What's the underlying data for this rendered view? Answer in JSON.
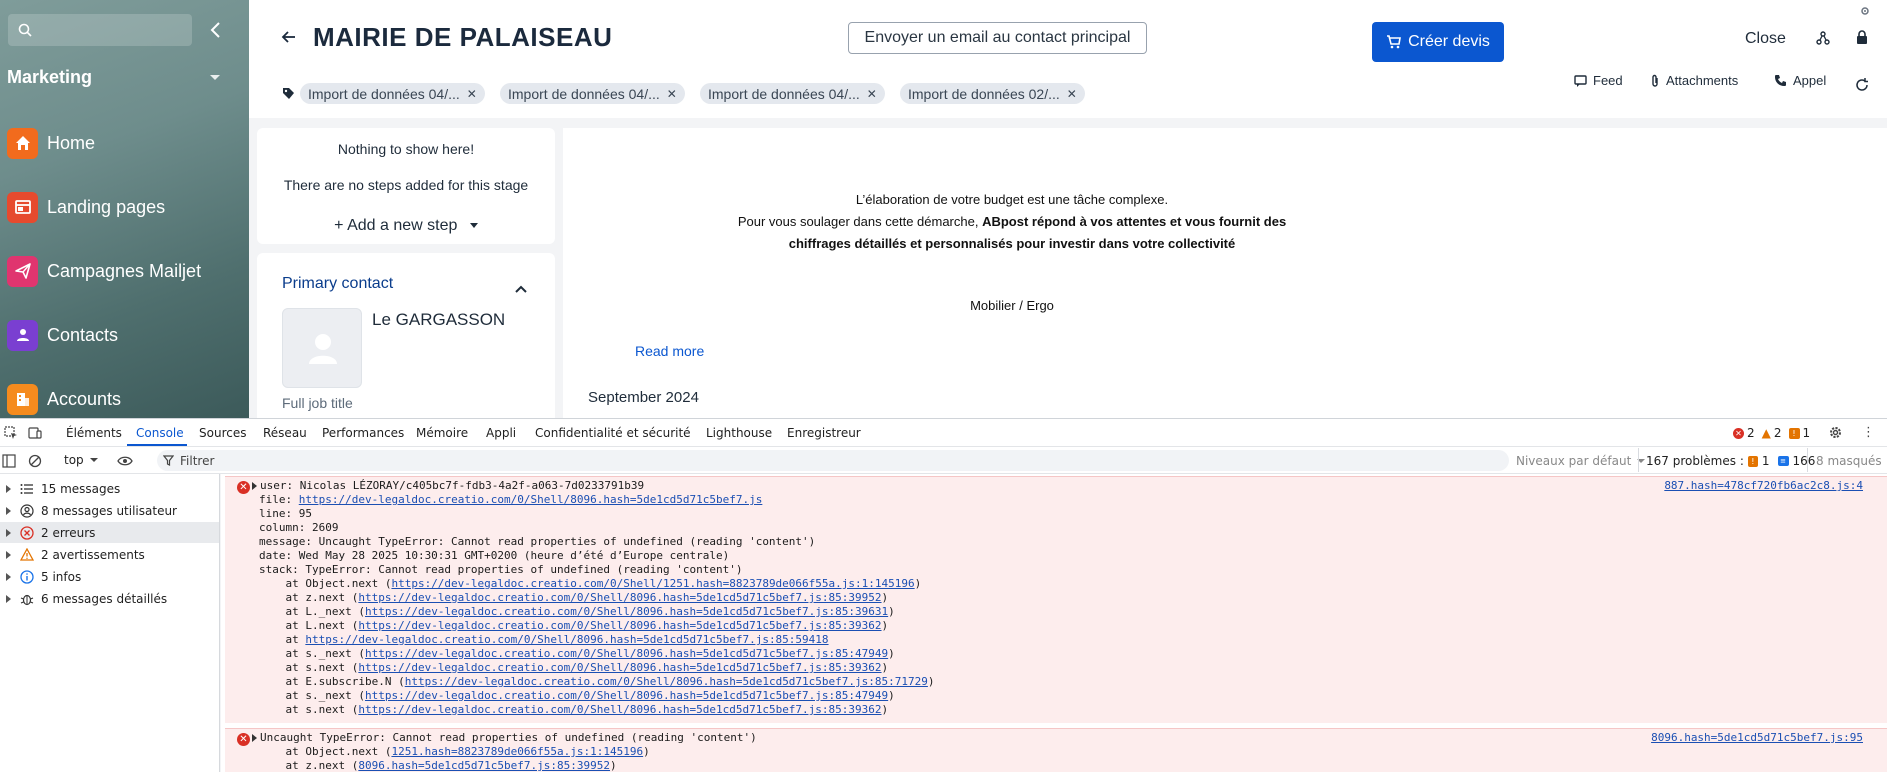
{
  "sidebar": {
    "workspace": "Marketing",
    "items": [
      {
        "label": "Home",
        "icon": "home-icon",
        "color": "#f26b1d"
      },
      {
        "label": "Landing pages",
        "icon": "landing-pages-icon",
        "color": "#e64a2e"
      },
      {
        "label": "Campagnes Mailjet",
        "icon": "send-icon",
        "color": "#e0356f"
      },
      {
        "label": "Contacts",
        "icon": "contact-icon",
        "color": "#7a3fd1"
      },
      {
        "label": "Accounts",
        "icon": "accounts-icon",
        "color": "#f58b1e"
      }
    ]
  },
  "header": {
    "title": "MAIRIE DE PALAISEAU",
    "email_button": "Envoyer un email au contact principal",
    "create_button": "Créer devis",
    "close": "Close",
    "tags": [
      "Import de données 04/...",
      "Import de données 04/...",
      "Import de données 04/...",
      "Import de données 02/..."
    ],
    "actions": {
      "feed": "Feed",
      "attachments": "Attachments",
      "call": "Appel"
    }
  },
  "steps": {
    "empty_title": "Nothing to show here!",
    "empty_text": "There are no steps added for this stage",
    "add_step": "Add a new step"
  },
  "contact": {
    "title": "Primary contact",
    "name": "Le GARGASSON",
    "job_title": "Full job title"
  },
  "feed": {
    "line1": "L’élaboration de votre budget est une tâche complexe.",
    "line2_plain": "Pour vous soulager dans cette démarche, ",
    "line2_bold": "ABpost répond à vos attentes et vous fournit des",
    "line3_bold": "chiffrages détaillés et personnalisés pour investir dans votre collectivité",
    "line4": "Mobilier / Ergo",
    "read_more": "Read more",
    "date": "September 2024"
  },
  "devtools": {
    "tabs": [
      "Éléments",
      "Console",
      "Sources",
      "Réseau",
      "Performances",
      "Mémoire",
      "Appli",
      "Confidentialité et sécurité",
      "Lighthouse",
      "Enregistreur"
    ],
    "badges": {
      "errors": "2",
      "warnings": "2",
      "issues": "1"
    },
    "context": "top",
    "filter_placeholder": "Filtrer",
    "levels": "Niveaux par défaut",
    "problems_label": "167 problèmes :",
    "problems_issues": "1",
    "problems_info": "166",
    "hidden": "8 masqués",
    "sidebar": [
      {
        "label": "15 messages",
        "icon": "list-icon"
      },
      {
        "label": "8 messages utilisateur",
        "icon": "user-icon"
      },
      {
        "label": "2 erreurs",
        "icon": "error-icon"
      },
      {
        "label": "2 avertissements",
        "icon": "warning-icon"
      },
      {
        "label": "5 infos",
        "icon": "info-icon"
      },
      {
        "label": "6 messages détaillés",
        "icon": "bug-icon"
      }
    ],
    "error1": {
      "source": "887.hash=478cf720fb6ac2c8.js:4",
      "user": "user: Nicolas LÉZORAY/c405bc7f-fdb3-4a2f-a063-7d0233791b39",
      "file_label": "file: ",
      "file_url": "https://dev-legaldoc.creatio.com/0/Shell/8096.hash=5de1cd5d71c5bef7.js",
      "line": "line: 95",
      "column": "column: 2609",
      "message": "message: Uncaught TypeError: Cannot read properties of undefined (reading 'content')",
      "date": "date: Wed May 28 2025 10:30:31 GMT+0200 (heure d’été d’Europe centrale)",
      "stack": "stack: TypeError: Cannot read properties of undefined (reading 'content')",
      "frames": [
        {
          "prefix": "    at Object.next (",
          "url": "https://dev-legaldoc.creatio.com/0/Shell/1251.hash=8823789de066f55a.js:1:145196",
          "suffix": ")"
        },
        {
          "prefix": "    at z.next (",
          "url": "https://dev-legaldoc.creatio.com/0/Shell/8096.hash=5de1cd5d71c5bef7.js:85:39952",
          "suffix": ")"
        },
        {
          "prefix": "    at L._next (",
          "url": "https://dev-legaldoc.creatio.com/0/Shell/8096.hash=5de1cd5d71c5bef7.js:85:39631",
          "suffix": ")"
        },
        {
          "prefix": "    at L.next (",
          "url": "https://dev-legaldoc.creatio.com/0/Shell/8096.hash=5de1cd5d71c5bef7.js:85:39362",
          "suffix": ")"
        },
        {
          "prefix": "    at ",
          "url": "https://dev-legaldoc.creatio.com/0/Shell/8096.hash=5de1cd5d71c5bef7.js:85:59418",
          "suffix": ""
        },
        {
          "prefix": "    at s._next (",
          "url": "https://dev-legaldoc.creatio.com/0/Shell/8096.hash=5de1cd5d71c5bef7.js:85:47949",
          "suffix": ")"
        },
        {
          "prefix": "    at s.next (",
          "url": "https://dev-legaldoc.creatio.com/0/Shell/8096.hash=5de1cd5d71c5bef7.js:85:39362",
          "suffix": ")"
        },
        {
          "prefix": "    at E.subscribe.N (",
          "url": "https://dev-legaldoc.creatio.com/0/Shell/8096.hash=5de1cd5d71c5bef7.js:85:71729",
          "suffix": ")"
        },
        {
          "prefix": "    at s._next (",
          "url": "https://dev-legaldoc.creatio.com/0/Shell/8096.hash=5de1cd5d71c5bef7.js:85:47949",
          "suffix": ")"
        },
        {
          "prefix": "    at s.next (",
          "url": "https://dev-legaldoc.creatio.com/0/Shell/8096.hash=5de1cd5d71c5bef7.js:85:39362",
          "suffix": ")"
        }
      ]
    },
    "error2": {
      "source": "8096.hash=5de1cd5d71c5bef7.js:95",
      "message": "Uncaught TypeError: Cannot read properties of undefined (reading 'content')",
      "frames": [
        {
          "prefix": "    at Object.next (",
          "url": "1251.hash=8823789de066f55a.js:1:145196",
          "suffix": ")"
        },
        {
          "prefix": "    at z.next (",
          "url": "8096.hash=5de1cd5d71c5bef7.js:85:39952",
          "suffix": ")"
        }
      ]
    }
  }
}
